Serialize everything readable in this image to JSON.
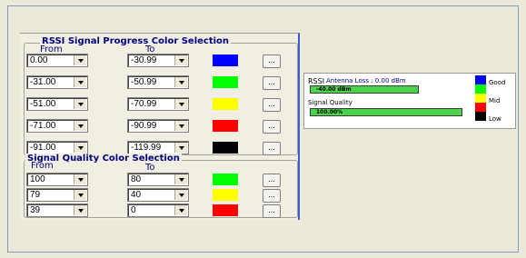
{
  "rssi_group": {
    "title": "RSSI Signal Progress Color Selection",
    "from_label": "From",
    "to_label": "To",
    "rows": [
      {
        "from": "0.00",
        "to": "-30.99",
        "color": "#0000FF"
      },
      {
        "from": "-31.00",
        "to": "-50.99",
        "color": "#00FF00"
      },
      {
        "from": "-51.00",
        "to": "-70.99",
        "color": "#FFFF00"
      },
      {
        "from": "-71.00",
        "to": "-90.99",
        "color": "#FF0000"
      },
      {
        "from": "-91.00",
        "to": "-119.99",
        "color": "#000000"
      }
    ]
  },
  "quality_group": {
    "title": "Signal Quality Color Selection",
    "from_label": "From",
    "to_label": "To",
    "rows": [
      {
        "from": "100",
        "to": "80",
        "color": "#00FF00"
      },
      {
        "from": "79",
        "to": "40",
        "color": "#FFFF00"
      },
      {
        "from": "39",
        "to": "0",
        "color": "#FF0000"
      }
    ]
  },
  "browse_label": "...",
  "preview": {
    "rssi_label": "RSSI",
    "antenna_loss": "Antenna Loss : 0.00 dBm",
    "rssi_value": "-40.00 dBm",
    "rssi_fill": 0.6,
    "quality_label": "Signal Quality",
    "quality_value": "100.00%",
    "quality_fill": 1.0,
    "bar_color": "#4CD34C",
    "legend": [
      {
        "label": "Good",
        "color": "#0000FF"
      },
      {
        "label": "",
        "color": "#00FF00"
      },
      {
        "label": "Mid",
        "color": "#FFFF00"
      },
      {
        "label": "",
        "color": "#FF0000"
      },
      {
        "label": "Low",
        "color": "#000000"
      }
    ]
  }
}
